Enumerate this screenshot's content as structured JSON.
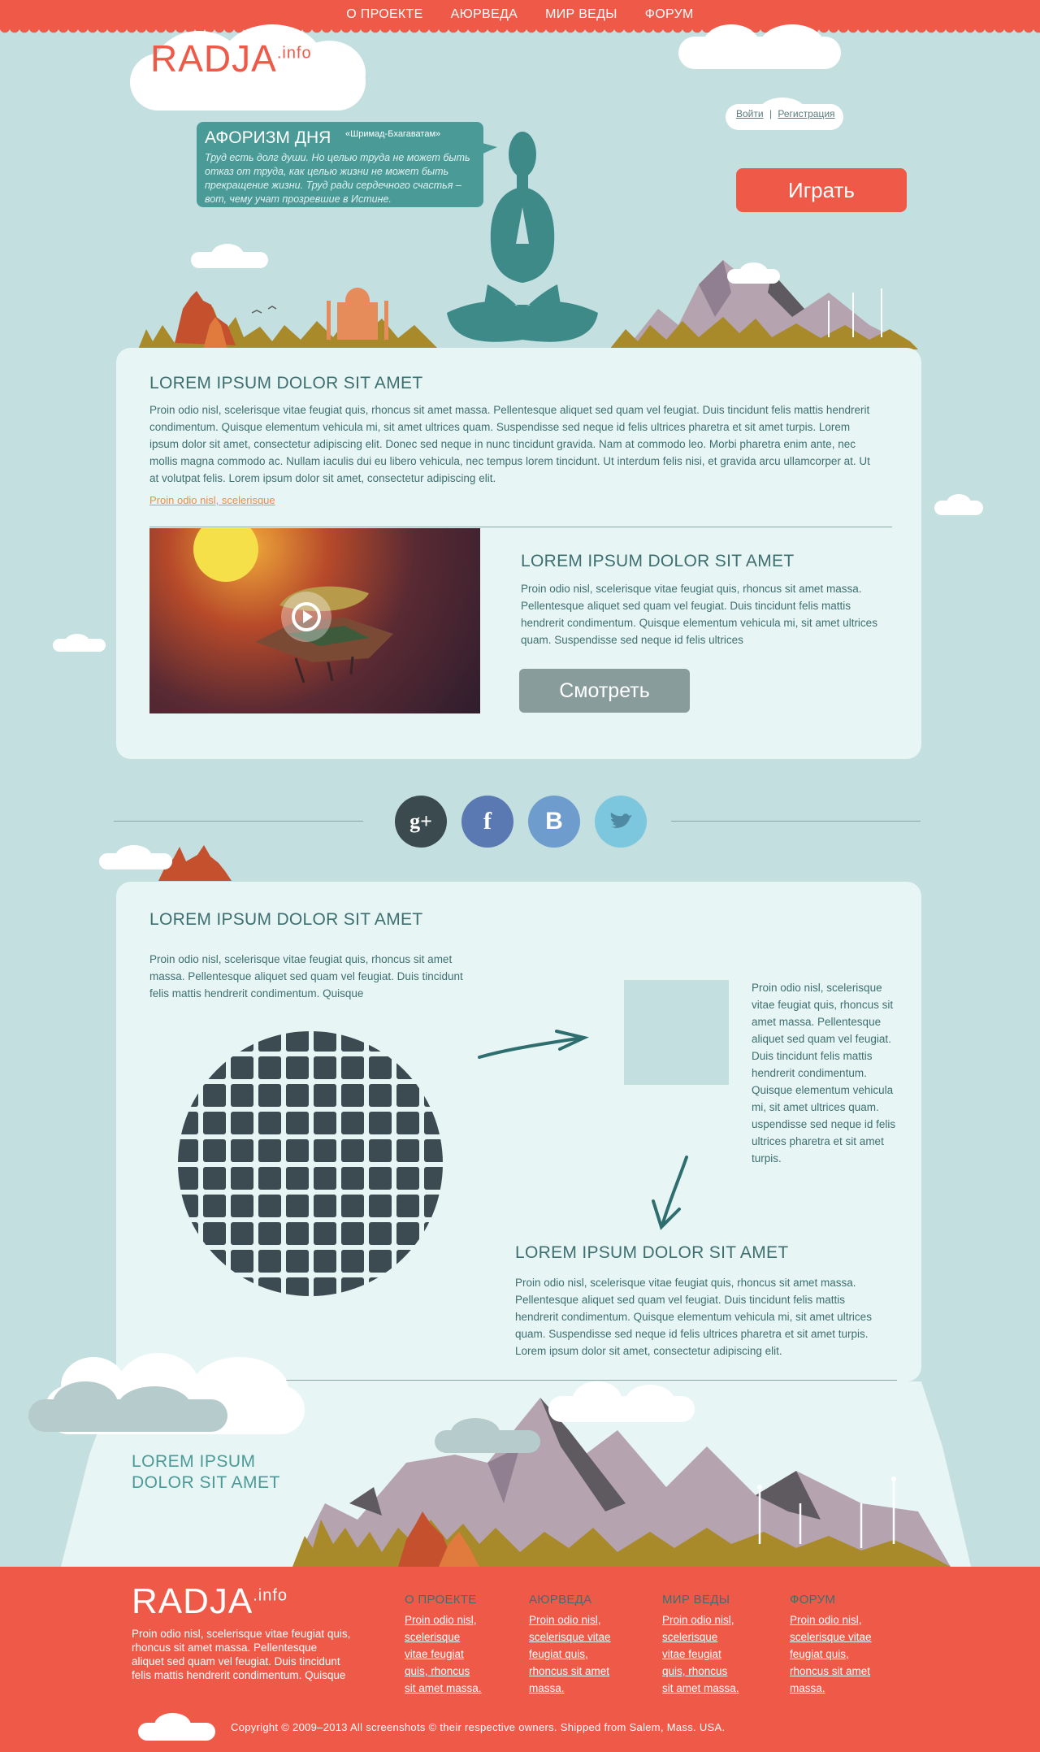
{
  "nav": [
    "О ПРОЕКТЕ",
    "АЮРВЕДА",
    "МИР ВЕДЫ",
    "ФОРУМ"
  ],
  "logo": {
    "main": "RADJA",
    "sup": ".info"
  },
  "auth": {
    "login": "Войти",
    "sep": "|",
    "register": "Регистрация"
  },
  "aphorism": {
    "title": "АФОРИЗМ ДНЯ",
    "source": "«Шримад-Бхагаватам»",
    "text": "Труд есть долг души. Но целью труда не может быть отказ от труда, как целью жизни не может быть прекращение жизни. Труд ради сердечного счастья – вот, чему учат прозревшие в Истине."
  },
  "play_button": "Играть",
  "section1": {
    "title": "LOREM IPSUM DOLOR SIT AMET",
    "text": "Proin odio nisl, scelerisque vitae feugiat quis, rhoncus sit amet massa. Pellentesque aliquet sed quam vel feugiat. Duis tincidunt felis mattis hendrerit condimentum. Quisque elementum vehicula mi, sit amet ultrices quam. Suspendisse sed neque id felis ultrices pharetra et sit amet turpis. Lorem ipsum dolor sit amet, consectetur adipiscing elit. Donec sed neque in nunc tincidunt gravida. Nam at commodo leo. Morbi pharetra enim ante, nec mollis magna commodo ac. Nullam iaculis dui eu libero vehicula, nec tempus lorem tincidunt. Ut interdum felis nisi, et gravida arcu ullamcorper at. Ut at volutpat felis. Lorem ipsum dolor sit amet, consectetur adipiscing elit.",
    "link": "Proin odio nisl, scelerisque"
  },
  "video": {
    "title": "LOREM IPSUM DOLOR SIT AMET",
    "text": "Proin odio nisl, scelerisque vitae feugiat quis, rhoncus sit amet massa. Pellentesque aliquet sed quam vel feugiat. Duis tincidunt felis mattis hendrerit condimentum. Quisque elementum vehicula mi, sit amet ultrices quam. Suspendisse sed neque id felis ultrices",
    "button": "Смотреть"
  },
  "social": [
    {
      "icon": "google-plus-icon",
      "glyph": "g+",
      "color": "#3a4a4f"
    },
    {
      "icon": "facebook-icon",
      "glyph": "f",
      "color": "#5a79b3"
    },
    {
      "icon": "vkontakte-icon",
      "glyph": "B",
      "color": "#6e9ccc"
    },
    {
      "icon": "twitter-icon",
      "glyph": "🐦",
      "color": "#7cc6de"
    }
  ],
  "section2": {
    "title": "LOREM IPSUM DOLOR SIT AMET",
    "intro": "Proin odio nisl, scelerisque vitae feugiat quis, rhoncus sit amet massa. Pellentesque aliquet sed quam vel feugiat. Duis tincidunt felis mattis hendrerit condimentum. Quisque",
    "side": "Proin odio nisl, scelerisque vitae feugiat quis, rhoncus sit amet massa. Pellentesque aliquet sed quam vel feugiat. Duis tincidunt felis mattis hendrerit condimentum. Quisque elementum vehicula mi, sit amet ultrices quam. uspendisse sed neque id felis ultrices pharetra et sit amet turpis.",
    "sub_title": "LOREM IPSUM DOLOR SIT AMET",
    "sub_text": "Proin odio nisl, scelerisque vitae feugiat quis, rhoncus sit amet massa. Pellentesque aliquet sed quam vel feugiat. Duis tincidunt felis mattis hendrerit condimentum. Quisque elementum vehicula mi, sit amet ultrices quam. Suspendisse sed neque id felis ultrices pharetra et sit amet turpis. Lorem ipsum dolor sit amet, consectetur adipiscing elit."
  },
  "landscape_caption": {
    "line1": "LOREM IPSUM",
    "line2": "DOLOR SIT AMET"
  },
  "footer": {
    "logo": "RADJA",
    "logo_sup": ".info",
    "about": "Proin odio nisl, scelerisque vitae feugiat quis, rhoncus sit amet massa. Pellentesque aliquet sed quam vel feugiat. Duis tincidunt felis mattis hendrerit condimentum. Quisque",
    "columns": [
      {
        "title": "О ПРОЕКТЕ",
        "links": [
          "Proin odio nisl,",
          "scelerisque",
          "vitae feugiat",
          "quis, rhoncus",
          "sit amet massa."
        ]
      },
      {
        "title": "АЮРВЕДА",
        "links": [
          "Proin odio nisl,",
          "scelerisque vitae",
          "feugiat quis,",
          "rhoncus sit amet",
          "massa."
        ]
      },
      {
        "title": "МИР ВЕДЫ",
        "links": [
          "Proin odio nisl,",
          "scelerisque",
          "vitae feugiat",
          "quis, rhoncus",
          "sit amet massa."
        ]
      },
      {
        "title": "ФОРУМ",
        "links": [
          "Proin odio nisl,",
          "scelerisque vitae",
          "feugiat quis,",
          "rhoncus sit amet",
          "massa."
        ]
      }
    ],
    "copyright": "Copyright © 2009–2013  All screenshots © their respective owners. Shipped from Salem, Mass. USA."
  },
  "colors": {
    "accent": "#ef5a48",
    "teal": "#4a9a97",
    "bg": "#c3dfe0",
    "card": "#e8f5f5",
    "dark": "#3c4a51"
  }
}
